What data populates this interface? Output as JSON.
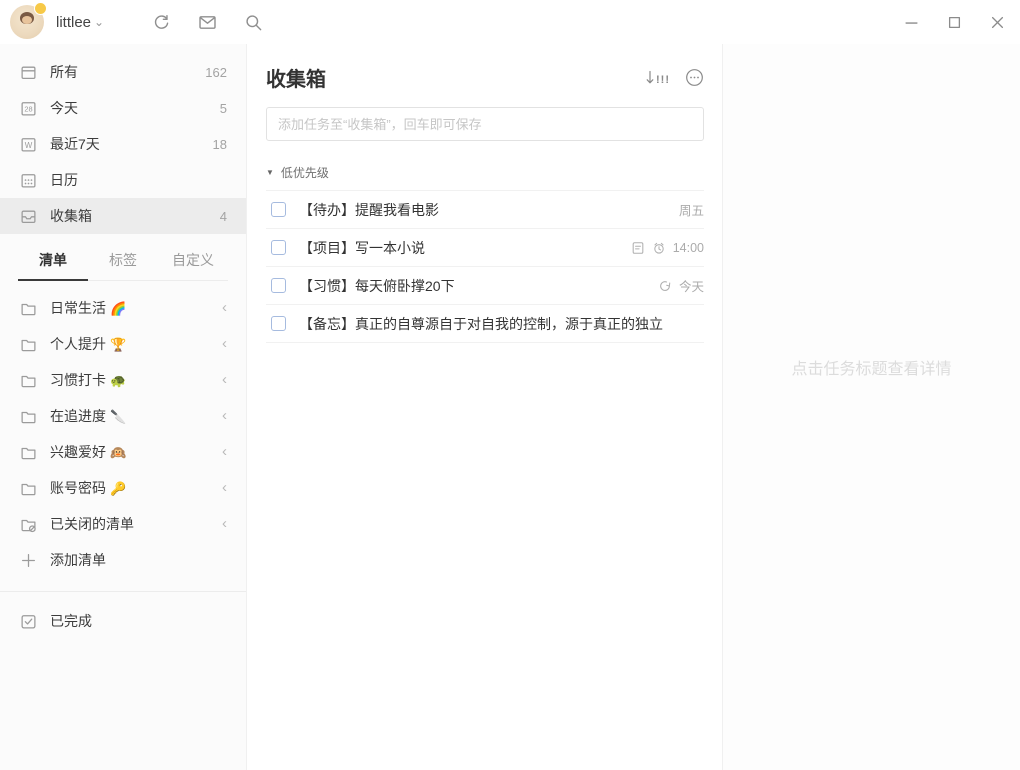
{
  "titlebar": {
    "username": "littlee"
  },
  "sidebar": {
    "smart_lists": [
      {
        "label": "所有",
        "count": "162"
      },
      {
        "label": "今天",
        "count": "5",
        "icon_text": "28"
      },
      {
        "label": "最近7天",
        "count": "18",
        "icon_text": "W"
      },
      {
        "label": "日历",
        "count": ""
      },
      {
        "label": "收集箱",
        "count": "4"
      }
    ],
    "tabs": [
      {
        "label": "清单"
      },
      {
        "label": "标签"
      },
      {
        "label": "自定义"
      }
    ],
    "folders": [
      {
        "label": "日常生活",
        "emoji": "🌈"
      },
      {
        "label": "个人提升",
        "emoji": "🏆"
      },
      {
        "label": "习惯打卡",
        "emoji": "🐢"
      },
      {
        "label": "在追进度",
        "emoji": "🔪"
      },
      {
        "label": "兴趣爱好",
        "emoji": "🙉"
      },
      {
        "label": "账号密码",
        "emoji": "🔑"
      },
      {
        "label": "已关闭的清单",
        "emoji": ""
      }
    ],
    "add_list_label": "添加清单",
    "completed_label": "已完成"
  },
  "main": {
    "title": "收集箱",
    "input_placeholder": "添加任务至“收集箱”，回车即可保存",
    "group_label": "低优先级",
    "tasks": [
      {
        "title": "【待办】提醒我看电影",
        "meta": "周五"
      },
      {
        "title": "【项目】写一本小说",
        "meta": "14:00"
      },
      {
        "title": "【习惯】每天俯卧撑20下",
        "meta": "今天"
      },
      {
        "title": "【备忘】真正的自尊源自于对自我的控制，源于真正的独立",
        "meta": ""
      }
    ]
  },
  "detail": {
    "hint": "点击任务标题查看详情"
  },
  "icons": {
    "sort_marks": "!!!",
    "collapse_chevron": "‹",
    "group_triangle": "▼",
    "username_chevron": "⌄"
  },
  "colors": {
    "checkbox_border": "#a6bbdf",
    "sidebar_bg": "#fbfbfb",
    "selected_row_bg": "#ececec",
    "badge_yellow": "#f7c948"
  }
}
